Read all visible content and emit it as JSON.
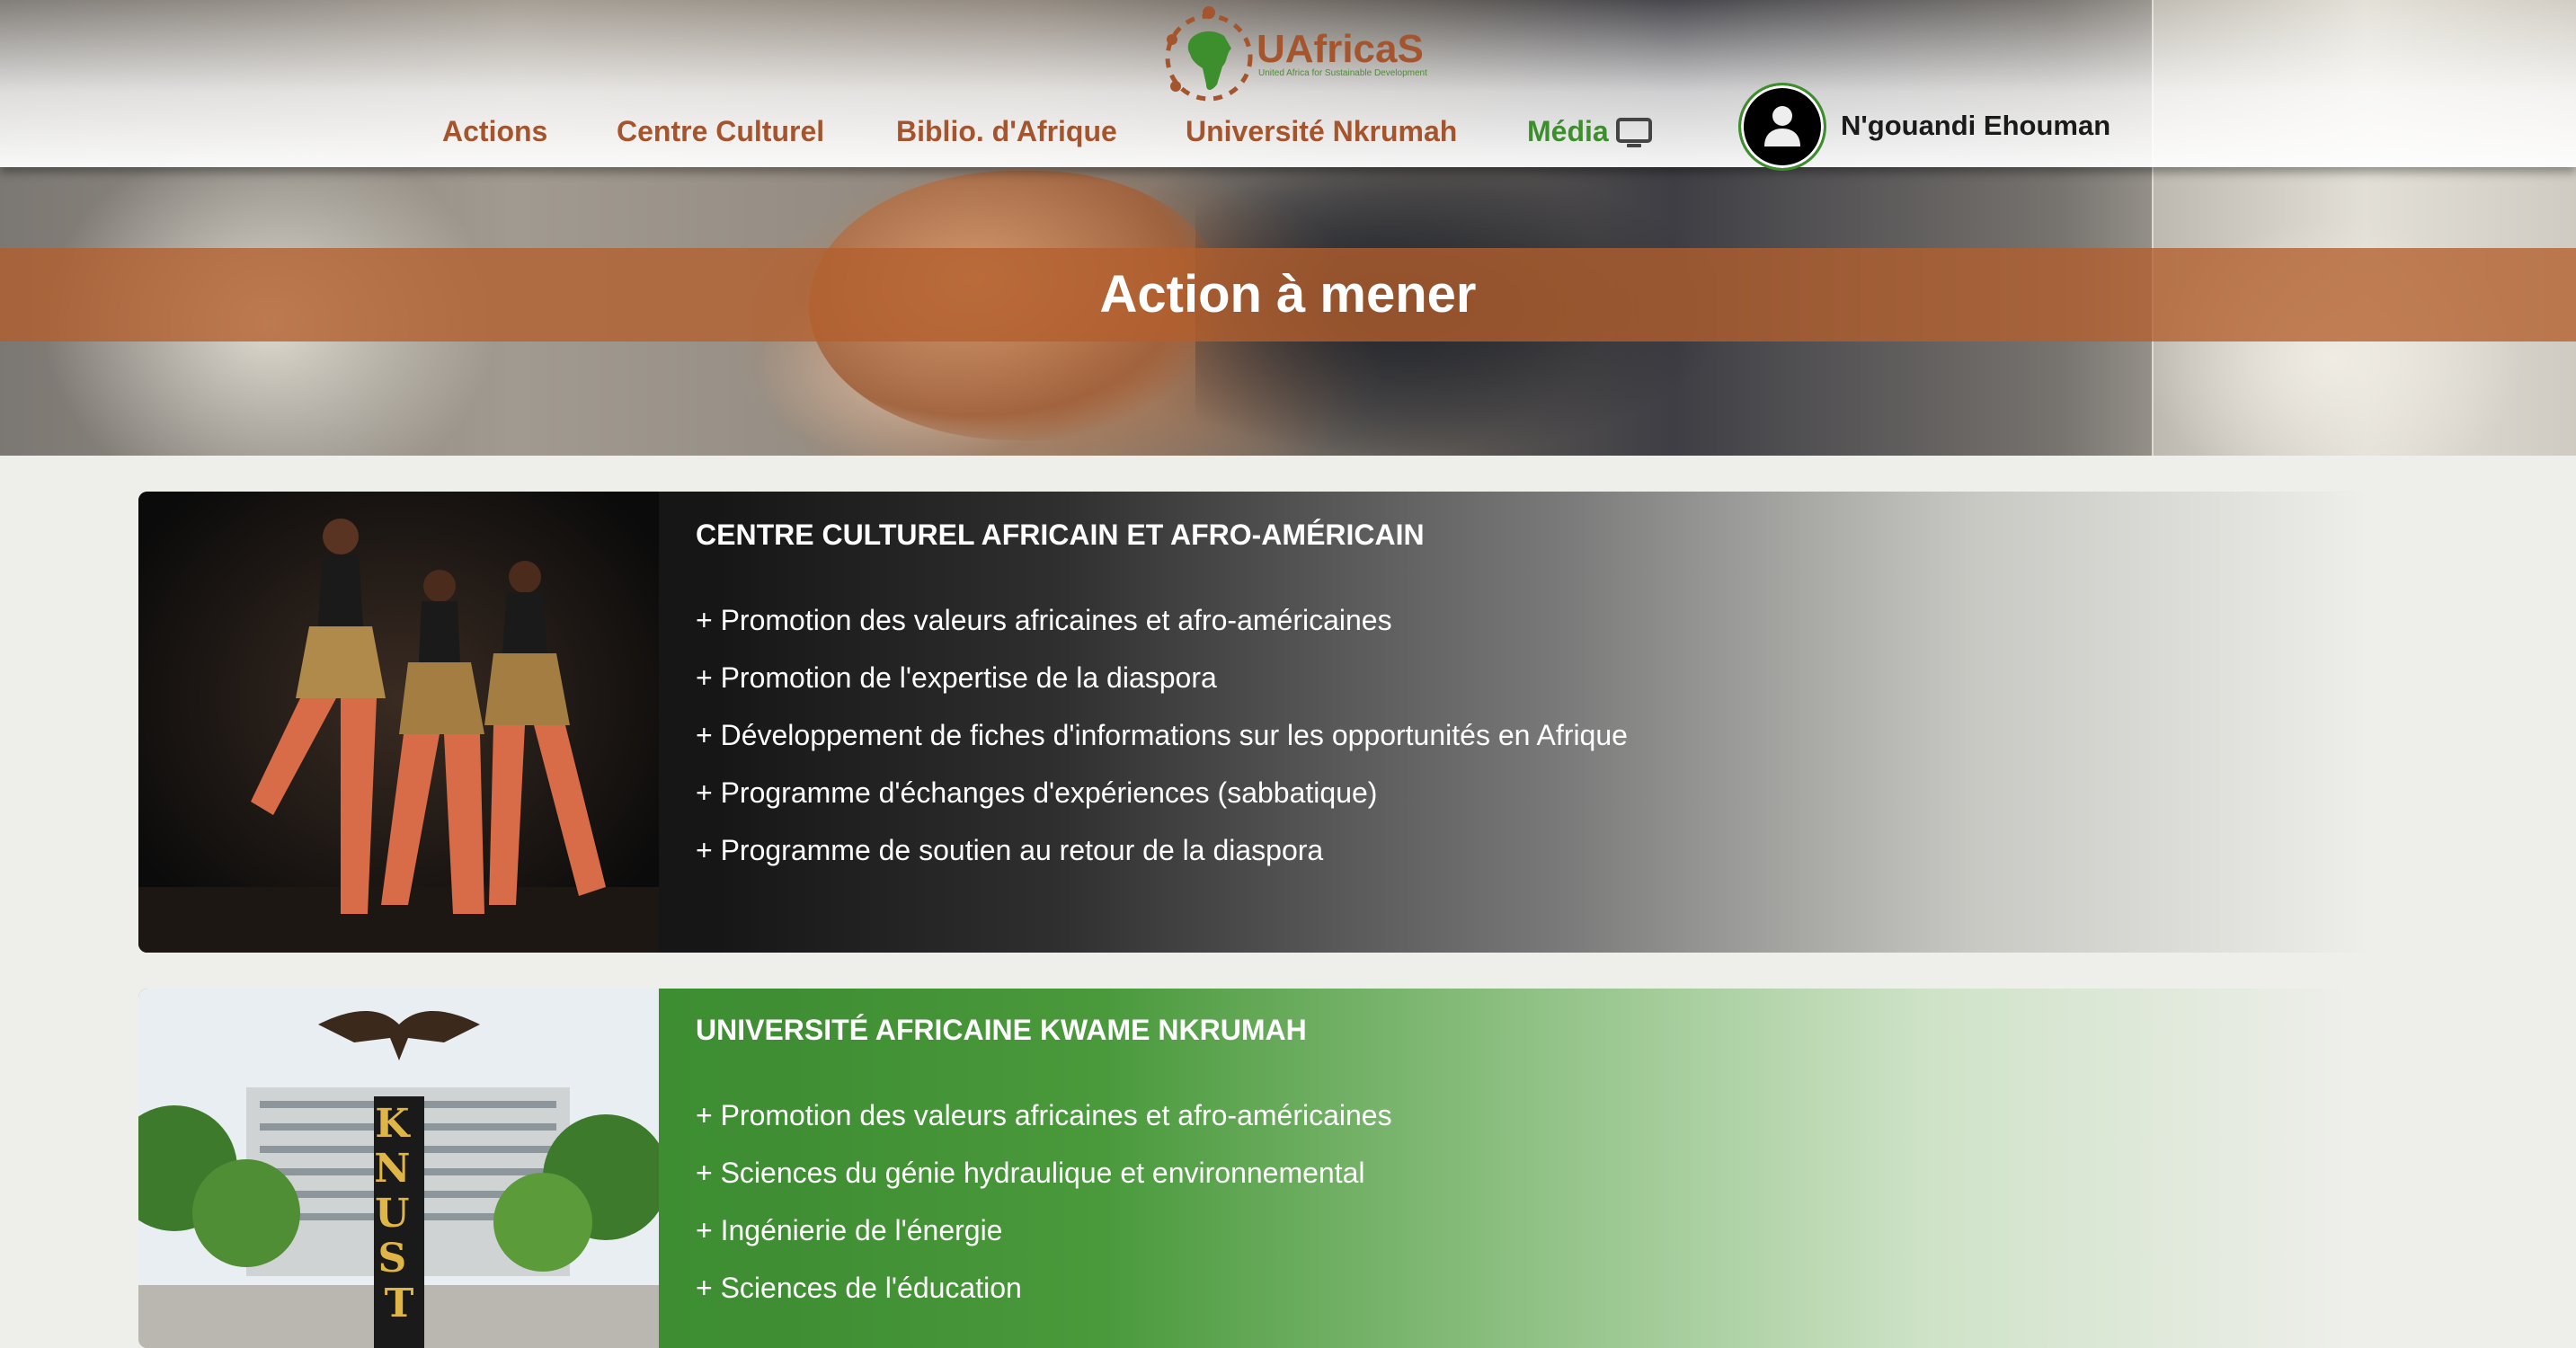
{
  "brand": {
    "name": "UAfricaS",
    "tagline": "United Africa for Sustainable Development",
    "colors": {
      "brown": "#a4552e",
      "green": "#3d8e2c"
    }
  },
  "nav": {
    "items": [
      {
        "label": "Actions"
      },
      {
        "label": "Centre Culturel"
      },
      {
        "label": "Biblio. d'Afrique"
      },
      {
        "label": "Université Nkrumah"
      },
      {
        "label": "Média",
        "icon": "tv-icon"
      }
    ]
  },
  "user": {
    "name": "N'gouandi  Ehouman",
    "icon": "user-icon"
  },
  "hero": {
    "title": "Action à mener"
  },
  "cards": [
    {
      "title": "CENTRE CULTUREL AFRICAIN ET AFRO-AMÉRICAIN",
      "items": [
        "+ Promotion des valeurs africaines et afro-américaines",
        "+ Promotion de l'expertise de la diaspora",
        "+ Développement de fiches d'informations sur les opportunités en Afrique",
        "+ Programme d'échanges d'expériences (sabbatique)",
        "+ Programme de soutien au retour de la diaspora"
      ]
    },
    {
      "title": "UNIVERSITÉ AFRICAINE KWAME NKRUMAH",
      "sign_letters": "KNUST",
      "items": [
        "+ Promotion des valeurs africaines et afro-américaines",
        "+ Sciences du génie hydraulique et environnemental",
        "+ Ingénierie de l'énergie",
        "+ Sciences de l'éducation"
      ]
    }
  ]
}
